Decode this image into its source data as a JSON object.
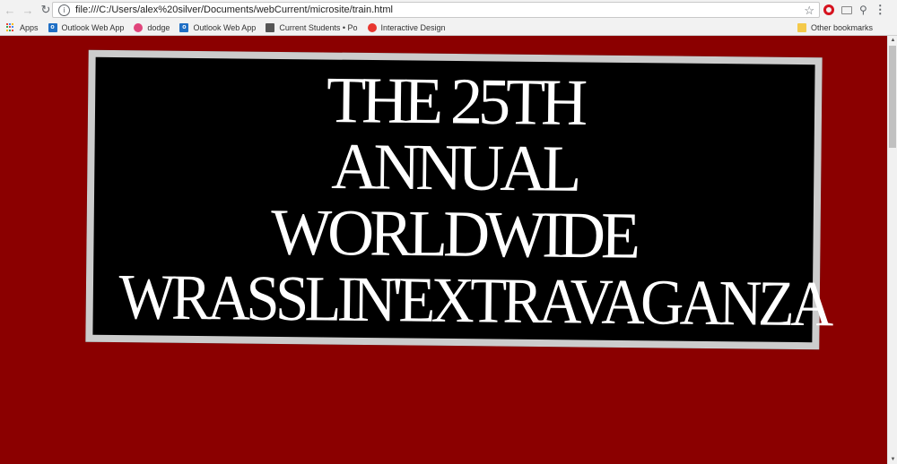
{
  "browser": {
    "url": "file:///C:/Users/alex%20silver/Documents/webCurrent/microsite/train.html",
    "bookmarks": [
      {
        "label": "Apps",
        "icon": "apps-icon"
      },
      {
        "label": "Outlook Web App",
        "icon": "outlook-icon"
      },
      {
        "label": "dodge",
        "icon": "dodge-icon"
      },
      {
        "label": "Outlook Web App",
        "icon": "outlook-icon"
      },
      {
        "label": "Current Students • Po",
        "icon": "chat-icon"
      },
      {
        "label": "Interactive Design",
        "icon": "interactive-design-icon"
      }
    ],
    "other_bookmarks": "Other bookmarks"
  },
  "page": {
    "background": "#8b0000",
    "banner": {
      "border_color": "#cccccc",
      "lines": [
        "THE 25TH",
        "ANNUAL",
        "WORLDWIDE",
        "WRASSLIN'EXTRAVAGANZA"
      ]
    }
  }
}
